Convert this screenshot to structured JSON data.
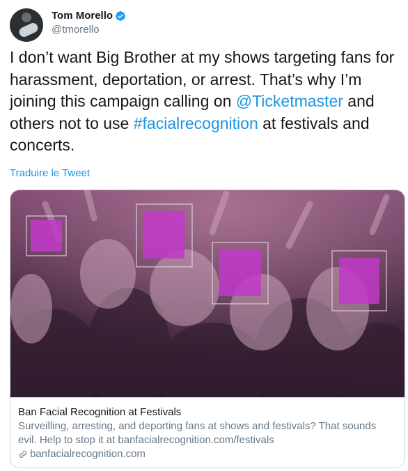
{
  "author": {
    "display_name": "Tom Morello",
    "handle": "@tmorello",
    "avatar_icon": "avatar-guitarist",
    "verified_icon": "verified-badge-icon"
  },
  "tweet": {
    "part1": "I don’t want Big Brother at my shows targeting fans for harassment, deportation, or arrest. That’s why I’m joining this campaign calling on ",
    "mention": "@Ticketmaster",
    "part2": " and others not to use ",
    "hashtag": "#facialrecognition",
    "part3": " at festivals and concerts."
  },
  "translate_label": "Traduire le Tweet",
  "card": {
    "title": "Ban Facial Recognition at Festivals",
    "description": "Surveilling, arresting, and deporting fans at shows and festivals? That sounds evil. Help to stop it at banfacialrecognition.com/festivals",
    "domain": "banfacialrecognition.com",
    "link_icon": "link-icon"
  },
  "colors": {
    "link": "#1b95e0",
    "text": "#14171a",
    "secondary": "#657786",
    "face_highlight": "#d13bdc"
  }
}
